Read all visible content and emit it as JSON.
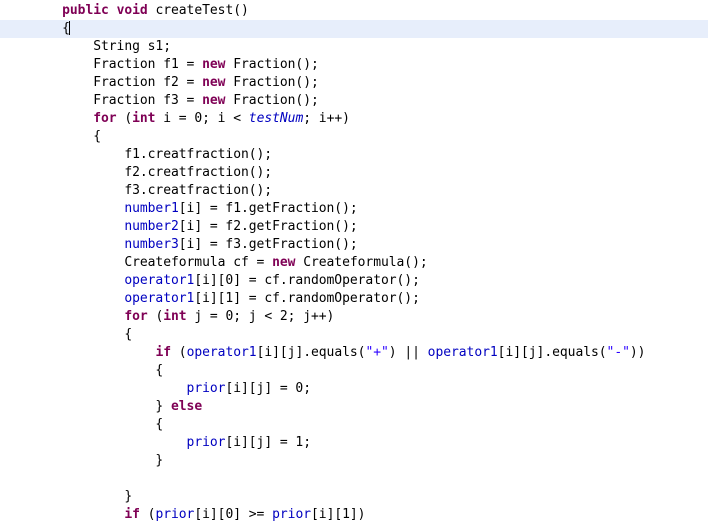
{
  "editor": {
    "language": "java",
    "background_color": "#ffffff",
    "current_line_highlight_color": "#e7eefb",
    "caret_line_index": 1,
    "colors": {
      "keyword": "#7f0055",
      "field": "#0000c0",
      "string": "#2a00ff",
      "plain": "#000000"
    }
  },
  "code": {
    "lines": [
      {
        "index": 0,
        "text": "    public void createTest()",
        "tokens": [
          {
            "t": "    ",
            "k": "plain"
          },
          {
            "t": "public",
            "k": "kw"
          },
          {
            "t": " ",
            "k": "plain"
          },
          {
            "t": "void",
            "k": "kw"
          },
          {
            "t": " createTest()",
            "k": "plain"
          }
        ]
      },
      {
        "index": 1,
        "text": "    {",
        "current": true,
        "tokens": [
          {
            "t": "    {",
            "k": "plain"
          }
        ]
      },
      {
        "index": 2,
        "text": "        String s1;",
        "tokens": [
          {
            "t": "        String s1;",
            "k": "plain"
          }
        ]
      },
      {
        "index": 3,
        "text": "        Fraction f1 = new Fraction();",
        "tokens": [
          {
            "t": "        Fraction f1 = ",
            "k": "plain"
          },
          {
            "t": "new",
            "k": "kw"
          },
          {
            "t": " Fraction();",
            "k": "plain"
          }
        ]
      },
      {
        "index": 4,
        "text": "        Fraction f2 = new Fraction();",
        "tokens": [
          {
            "t": "        Fraction f2 = ",
            "k": "plain"
          },
          {
            "t": "new",
            "k": "kw"
          },
          {
            "t": " Fraction();",
            "k": "plain"
          }
        ]
      },
      {
        "index": 5,
        "text": "        Fraction f3 = new Fraction();",
        "tokens": [
          {
            "t": "        Fraction f3 = ",
            "k": "plain"
          },
          {
            "t": "new",
            "k": "kw"
          },
          {
            "t": " Fraction();",
            "k": "plain"
          }
        ]
      },
      {
        "index": 6,
        "text": "        for (int i = 0; i < testNum; i++)",
        "tokens": [
          {
            "t": "        ",
            "k": "plain"
          },
          {
            "t": "for",
            "k": "kw"
          },
          {
            "t": " (",
            "k": "plain"
          },
          {
            "t": "int",
            "k": "kw"
          },
          {
            "t": " i = 0; i < ",
            "k": "plain"
          },
          {
            "t": "testNum",
            "k": "static"
          },
          {
            "t": "; i++)",
            "k": "plain"
          }
        ]
      },
      {
        "index": 7,
        "text": "        {",
        "tokens": [
          {
            "t": "        {",
            "k": "plain"
          }
        ]
      },
      {
        "index": 8,
        "text": "            f1.creatfraction();",
        "tokens": [
          {
            "t": "            f1.creatfraction();",
            "k": "plain"
          }
        ]
      },
      {
        "index": 9,
        "text": "            f2.creatfraction();",
        "tokens": [
          {
            "t": "            f2.creatfraction();",
            "k": "plain"
          }
        ]
      },
      {
        "index": 10,
        "text": "            f3.creatfraction();",
        "tokens": [
          {
            "t": "            f3.creatfraction();",
            "k": "plain"
          }
        ]
      },
      {
        "index": 11,
        "text": "            number1[i] = f1.getFraction();",
        "tokens": [
          {
            "t": "            ",
            "k": "plain"
          },
          {
            "t": "number1",
            "k": "field"
          },
          {
            "t": "[i] = f1.getFraction();",
            "k": "plain"
          }
        ]
      },
      {
        "index": 12,
        "text": "            number2[i] = f2.getFraction();",
        "tokens": [
          {
            "t": "            ",
            "k": "plain"
          },
          {
            "t": "number2",
            "k": "field"
          },
          {
            "t": "[i] = f2.getFraction();",
            "k": "plain"
          }
        ]
      },
      {
        "index": 13,
        "text": "            number3[i] = f3.getFraction();",
        "tokens": [
          {
            "t": "            ",
            "k": "plain"
          },
          {
            "t": "number3",
            "k": "field"
          },
          {
            "t": "[i] = f3.getFraction();",
            "k": "plain"
          }
        ]
      },
      {
        "index": 14,
        "text": "            Createformula cf = new Createformula();",
        "tokens": [
          {
            "t": "            Createformula cf = ",
            "k": "plain"
          },
          {
            "t": "new",
            "k": "kw"
          },
          {
            "t": " Createformula();",
            "k": "plain"
          }
        ]
      },
      {
        "index": 15,
        "text": "            operator1[i][0] = cf.randomOperator();",
        "tokens": [
          {
            "t": "            ",
            "k": "plain"
          },
          {
            "t": "operator1",
            "k": "field"
          },
          {
            "t": "[i][0] = cf.randomOperator();",
            "k": "plain"
          }
        ]
      },
      {
        "index": 16,
        "text": "            operator1[i][1] = cf.randomOperator();",
        "tokens": [
          {
            "t": "            ",
            "k": "plain"
          },
          {
            "t": "operator1",
            "k": "field"
          },
          {
            "t": "[i][1] = cf.randomOperator();",
            "k": "plain"
          }
        ]
      },
      {
        "index": 17,
        "text": "            for (int j = 0; j < 2; j++)",
        "tokens": [
          {
            "t": "            ",
            "k": "plain"
          },
          {
            "t": "for",
            "k": "kw"
          },
          {
            "t": " (",
            "k": "plain"
          },
          {
            "t": "int",
            "k": "kw"
          },
          {
            "t": " j = 0; j < 2; j++)",
            "k": "plain"
          }
        ]
      },
      {
        "index": 18,
        "text": "            {",
        "tokens": [
          {
            "t": "            {",
            "k": "plain"
          }
        ]
      },
      {
        "index": 19,
        "text": "                if (operator1[i][j].equals(\"+\") || operator1[i][j].equals(\"-\"))",
        "tokens": [
          {
            "t": "                ",
            "k": "plain"
          },
          {
            "t": "if",
            "k": "kw"
          },
          {
            "t": " (",
            "k": "plain"
          },
          {
            "t": "operator1",
            "k": "field"
          },
          {
            "t": "[i][j].equals(",
            "k": "plain"
          },
          {
            "t": "\"+\"",
            "k": "string"
          },
          {
            "t": ") || ",
            "k": "plain"
          },
          {
            "t": "operator1",
            "k": "field"
          },
          {
            "t": "[i][j].equals(",
            "k": "plain"
          },
          {
            "t": "\"-\"",
            "k": "string"
          },
          {
            "t": "))",
            "k": "plain"
          }
        ]
      },
      {
        "index": 20,
        "text": "                {",
        "tokens": [
          {
            "t": "                {",
            "k": "plain"
          }
        ]
      },
      {
        "index": 21,
        "text": "                    prior[i][j] = 0;",
        "tokens": [
          {
            "t": "                    ",
            "k": "plain"
          },
          {
            "t": "prior",
            "k": "field"
          },
          {
            "t": "[i][j] = 0;",
            "k": "plain"
          }
        ]
      },
      {
        "index": 22,
        "text": "                } else",
        "tokens": [
          {
            "t": "                } ",
            "k": "plain"
          },
          {
            "t": "else",
            "k": "kw"
          }
        ]
      },
      {
        "index": 23,
        "text": "                {",
        "tokens": [
          {
            "t": "                {",
            "k": "plain"
          }
        ]
      },
      {
        "index": 24,
        "text": "                    prior[i][j] = 1;",
        "tokens": [
          {
            "t": "                    ",
            "k": "plain"
          },
          {
            "t": "prior",
            "k": "field"
          },
          {
            "t": "[i][j] = 1;",
            "k": "plain"
          }
        ]
      },
      {
        "index": 25,
        "text": "                }",
        "tokens": [
          {
            "t": "                }",
            "k": "plain"
          }
        ]
      },
      {
        "index": 26,
        "text": "",
        "tokens": [
          {
            "t": "",
            "k": "plain"
          }
        ]
      },
      {
        "index": 27,
        "text": "            }",
        "tokens": [
          {
            "t": "            }",
            "k": "plain"
          }
        ]
      },
      {
        "index": 28,
        "text": "            if (prior[i][0] >= prior[i][1])",
        "tokens": [
          {
            "t": "            ",
            "k": "plain"
          },
          {
            "t": "if",
            "k": "kw"
          },
          {
            "t": " (",
            "k": "plain"
          },
          {
            "t": "prior",
            "k": "field"
          },
          {
            "t": "[i][0] >= ",
            "k": "plain"
          },
          {
            "t": "prior",
            "k": "field"
          },
          {
            "t": "[i][1])",
            "k": "plain"
          }
        ]
      }
    ]
  }
}
